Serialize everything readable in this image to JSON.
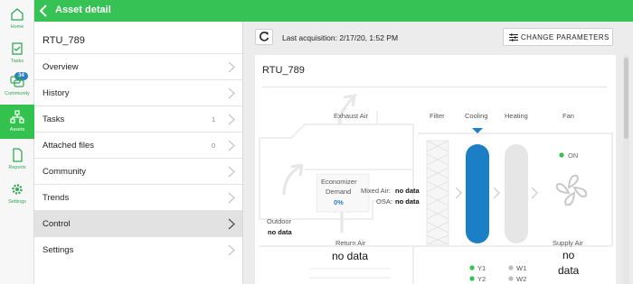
{
  "rail": {
    "items": [
      {
        "label": "Home",
        "icon": "home-icon"
      },
      {
        "label": "Tasks",
        "icon": "tasks-icon"
      },
      {
        "label": "Community",
        "icon": "community-icon",
        "badge": "34"
      },
      {
        "label": "Assets",
        "icon": "assets-icon",
        "active": true
      },
      {
        "label": "Reports",
        "icon": "reports-icon"
      },
      {
        "label": "Settings",
        "icon": "settings-icon"
      }
    ]
  },
  "topbar": {
    "title": "Asset detail"
  },
  "side": {
    "asset_name": "RTU_789",
    "menu": [
      {
        "label": "Overview",
        "count": ""
      },
      {
        "label": "History",
        "count": ""
      },
      {
        "label": "Tasks",
        "count": "1"
      },
      {
        "label": "Attached files",
        "count": "0"
      },
      {
        "label": "Community",
        "count": ""
      },
      {
        "label": "Trends",
        "count": ""
      },
      {
        "label": "Control",
        "count": "",
        "active": true
      },
      {
        "label": "Settings",
        "count": ""
      }
    ]
  },
  "main": {
    "acquisition": "Last acquisition: 2/17/20, 1:52 PM",
    "change_params": "CHANGE PARAMETERS",
    "card_title": "RTU_789",
    "diagram": {
      "exhaust_air": "Exhaust Air",
      "filter": "Filter",
      "cooling": "Cooling",
      "heating": "Heating",
      "fan": "Fan",
      "fan_status": "ON",
      "economizer": "Economizer",
      "demand": "Demand",
      "demand_value": "0%",
      "mixed_air_label": "Mixed Air:",
      "mixed_air_value": "no data",
      "osa_label": "OSA:",
      "osa_value": "no data",
      "outdoor_label": "Outdoor",
      "outdoor_value": "no data",
      "return_air_label": "Return Air",
      "return_air_value": "no data",
      "supply_air_label": "Supply Air",
      "supply_air_value_1": "no",
      "supply_air_value_2": "data",
      "y1": "Y1",
      "y2": "Y2",
      "w1": "W1",
      "w2": "W2"
    }
  },
  "colors": {
    "brand_green": "#36c254",
    "cooling_blue": "#1a7fc4",
    "demand_blue": "#2a7fbf",
    "badge_blue": "#2a7fbf",
    "status_green": "#33c24d",
    "status_gray": "#bdbdbd"
  }
}
